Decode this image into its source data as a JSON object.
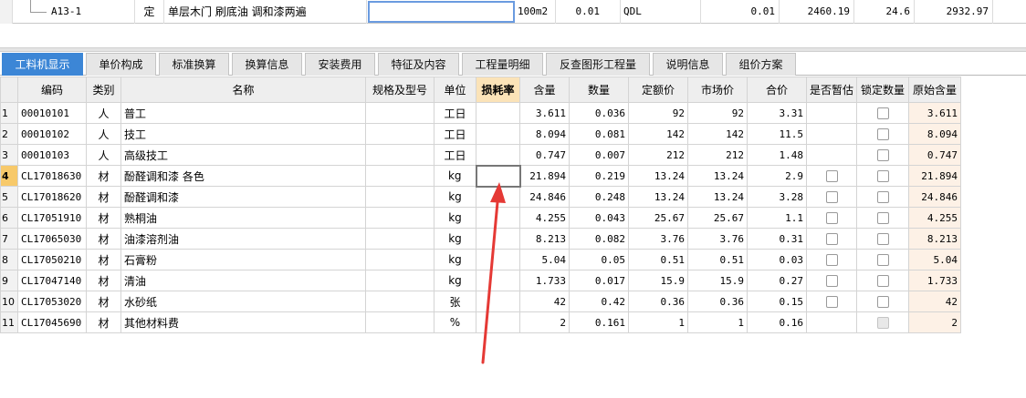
{
  "top_row": {
    "code": "A13-1",
    "type": "定",
    "name": "单层木门 刷底油 调和漆两遍",
    "unit": "100m2",
    "quantity": "0.01",
    "expr": "QDL",
    "col_a": "0.01",
    "col_b": "2460.19",
    "col_c": "24.6",
    "col_d": "2932.97"
  },
  "tabs": [
    "工料机显示",
    "单价构成",
    "标准换算",
    "换算信息",
    "安装费用",
    "特征及内容",
    "工程量明细",
    "反查图形工程量",
    "说明信息",
    "组价方案"
  ],
  "headers": [
    "编码",
    "类别",
    "名称",
    "规格及型号",
    "单位",
    "损耗率",
    "含量",
    "数量",
    "定额价",
    "市场价",
    "合价",
    "是否暂估",
    "锁定数量",
    "原始含量"
  ],
  "rows": [
    {
      "no": "1",
      "code": "00010101",
      "cat": "人",
      "name": "普工",
      "unit": "工日",
      "content": "3.611",
      "qty": "0.036",
      "price": "92",
      "market": "92",
      "total": "3.31",
      "est": false,
      "lock": "on",
      "orig": "3.611"
    },
    {
      "no": "2",
      "code": "00010102",
      "cat": "人",
      "name": "技工",
      "unit": "工日",
      "content": "8.094",
      "qty": "0.081",
      "price": "142",
      "market": "142",
      "total": "11.5",
      "est": false,
      "lock": "on",
      "orig": "8.094"
    },
    {
      "no": "3",
      "code": "00010103",
      "cat": "人",
      "name": "高级技工",
      "unit": "工日",
      "content": "0.747",
      "qty": "0.007",
      "price": "212",
      "market": "212",
      "total": "1.48",
      "est": false,
      "lock": "on",
      "orig": "0.747"
    },
    {
      "no": "4",
      "code": "CL17018630",
      "cat": "材",
      "name": "酚醛调和漆 各色",
      "unit": "kg",
      "content": "21.894",
      "qty": "0.219",
      "price": "13.24",
      "market": "13.24",
      "total": "2.9",
      "est": true,
      "lock": "on",
      "orig": "21.894"
    },
    {
      "no": "5",
      "code": "CL17018620",
      "cat": "材",
      "name": "酚醛调和漆",
      "unit": "kg",
      "content": "24.846",
      "qty": "0.248",
      "price": "13.24",
      "market": "13.24",
      "total": "3.28",
      "est": true,
      "lock": "on",
      "orig": "24.846"
    },
    {
      "no": "6",
      "code": "CL17051910",
      "cat": "材",
      "name": "熟桐油",
      "unit": "kg",
      "content": "4.255",
      "qty": "0.043",
      "price": "25.67",
      "market": "25.67",
      "total": "1.1",
      "est": true,
      "lock": "on",
      "orig": "4.255"
    },
    {
      "no": "7",
      "code": "CL17065030",
      "cat": "材",
      "name": "油漆溶剂油",
      "unit": "kg",
      "content": "8.213",
      "qty": "0.082",
      "price": "3.76",
      "market": "3.76",
      "total": "0.31",
      "est": true,
      "lock": "on",
      "orig": "8.213"
    },
    {
      "no": "8",
      "code": "CL17050210",
      "cat": "材",
      "name": "石膏粉",
      "unit": "kg",
      "content": "5.04",
      "qty": "0.05",
      "price": "0.51",
      "market": "0.51",
      "total": "0.03",
      "est": true,
      "lock": "on",
      "orig": "5.04"
    },
    {
      "no": "9",
      "code": "CL17047140",
      "cat": "材",
      "name": "清油",
      "unit": "kg",
      "content": "1.733",
      "qty": "0.017",
      "price": "15.9",
      "market": "15.9",
      "total": "0.27",
      "est": true,
      "lock": "on",
      "orig": "1.733"
    },
    {
      "no": "10",
      "code": "CL17053020",
      "cat": "材",
      "name": "水砂纸",
      "unit": "张",
      "content": "42",
      "qty": "0.42",
      "price": "0.36",
      "market": "0.36",
      "total": "0.15",
      "est": true,
      "lock": "on",
      "orig": "42"
    },
    {
      "no": "11",
      "code": "CL17045690",
      "cat": "材",
      "name": "其他材料费",
      "unit": "%",
      "content": "2",
      "qty": "0.161",
      "price": "1",
      "market": "1",
      "total": "0.16",
      "est": false,
      "lock": "disabled",
      "orig": "2"
    }
  ],
  "current_row": "4",
  "colors": {
    "tab_active": "#3c86d6",
    "header_highlight": "#fbe3b8",
    "arrow": "#e53935"
  }
}
